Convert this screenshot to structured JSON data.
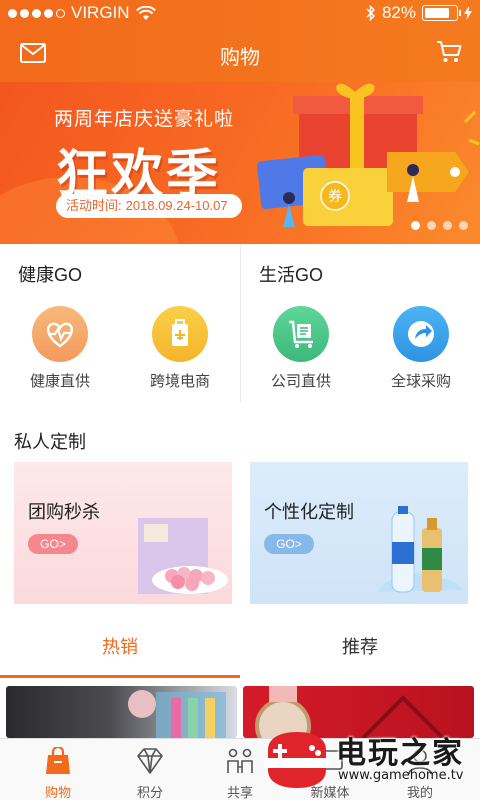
{
  "status_bar": {
    "carrier": "VIRGIN",
    "battery": "82%",
    "battery_level": 0.82
  },
  "nav": {
    "title": "购物"
  },
  "banner": {
    "subtitle": "两周年店庆送豪礼啦",
    "headline": "狂欢季",
    "period_label": "活动时间:",
    "period": "2018.09.24-10.07",
    "coupon_text": "券"
  },
  "health_go": {
    "title": "健康GO",
    "items": [
      {
        "label": "健康直供",
        "icon": "heartbeat-icon",
        "color": "#f4a86a"
      },
      {
        "label": "跨境电商",
        "icon": "luggage-plane-icon",
        "color": "#f7c23a"
      }
    ]
  },
  "life_go": {
    "title": "生活GO",
    "items": [
      {
        "label": "公司直供",
        "icon": "cart-box-icon",
        "color": "#4cc68a"
      },
      {
        "label": "全球采购",
        "icon": "share-arrow-icon",
        "color": "#3aa2ea"
      }
    ]
  },
  "custom": {
    "title": "私人定制",
    "cards": [
      {
        "title": "团购秒杀",
        "button": "GO>"
      },
      {
        "title": "个性化定制",
        "button": "GO>"
      }
    ]
  },
  "tabs": {
    "hot": "热销",
    "recommend": "推荐"
  },
  "tabbar": [
    {
      "label": "购物",
      "icon": "shopping-bag-icon"
    },
    {
      "label": "积分",
      "icon": "diamond-icon"
    },
    {
      "label": "共享",
      "icon": "share-people-icon"
    },
    {
      "label": "新媒体",
      "icon": "media-icon"
    },
    {
      "label": "我的",
      "icon": "user-icon"
    }
  ],
  "watermark": {
    "name": "电玩之家",
    "url": "www.gamehome.tv"
  },
  "colors": {
    "accent": "#f26a1b"
  }
}
